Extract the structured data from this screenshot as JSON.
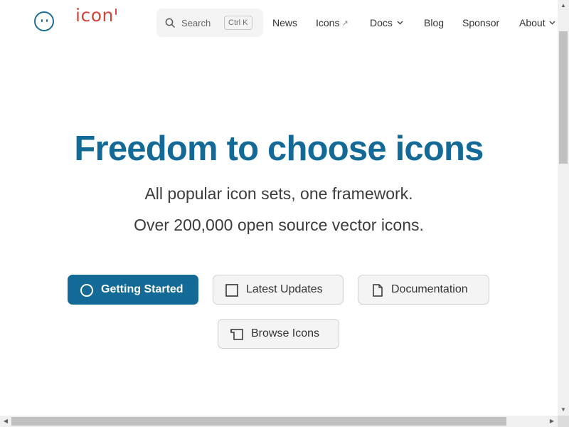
{
  "header": {
    "logo_text": "icon",
    "search": {
      "placeholder": "Search",
      "shortcut": "Ctrl K"
    },
    "nav": {
      "news": "News",
      "icons": "Icons",
      "docs": "Docs",
      "blog": "Blog",
      "sponsor": "Sponsor",
      "about": "About"
    }
  },
  "hero": {
    "title": "Freedom to choose icons",
    "line1": "All popular icon sets, one framework.",
    "line2": "Over 200,000 open source vector icons."
  },
  "buttons": {
    "getting_started": "Getting Started",
    "latest_updates": "Latest Updates",
    "documentation": "Documentation",
    "browse_icons": "Browse Icons"
  },
  "icons": {
    "logo": "smiley-face-icon",
    "search": "search-icon",
    "external": "external-link-arrow-icon",
    "chevron": "chevron-down-icon",
    "getting_started": "circle-icon",
    "latest_updates": "square-icon",
    "documentation": "document-icon",
    "browse_icons": "browser-window-icon"
  },
  "colors": {
    "accent": "#136a96",
    "logo_text": "#d2453b",
    "button_secondary_bg": "#f4f4f5"
  }
}
